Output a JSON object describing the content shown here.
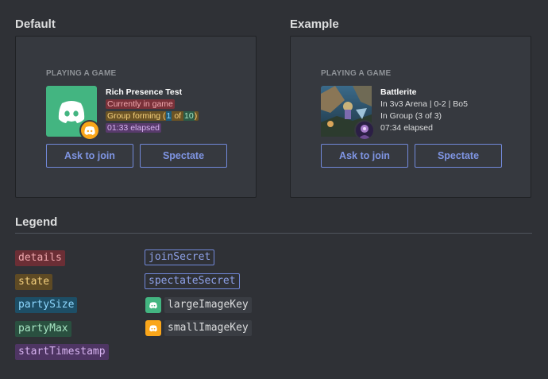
{
  "sections": {
    "default_title": "Default",
    "example_title": "Example",
    "legend_title": "Legend"
  },
  "default_card": {
    "playing_label": "PLAYING A GAME",
    "game_name": "Rich Presence Test",
    "details": "Currently in game",
    "state": "Group forming",
    "party_open": "(",
    "party_size": "1",
    "party_of": "of",
    "party_max": "10",
    "party_close": ")",
    "elapsed": "01:33 elapsed",
    "ask_button": "Ask to join",
    "spectate_button": "Spectate",
    "large_image_color": "#43b581",
    "small_image_color": "#faa61a"
  },
  "example_card": {
    "playing_label": "PLAYING A GAME",
    "game_name": "Battlerite",
    "details": "In 3v3 Arena | 0-2 | Bo5",
    "state": "In Group (3 of 3)",
    "elapsed": "07:34 elapsed",
    "ask_button": "Ask to join",
    "spectate_button": "Spectate"
  },
  "legend": {
    "details": "details",
    "state": "state",
    "party_size": "partySize",
    "party_max": "partyMax",
    "start_timestamp": "startTimestamp",
    "join_secret": "joinSecret",
    "spectate_secret": "spectateSecret",
    "large_image_key": "largeImageKey",
    "small_image_key": "smallImageKey"
  },
  "colors": {
    "background": "#2f3136",
    "panel": "#36393f",
    "accent": "#7289da",
    "green": "#43b581",
    "orange": "#faa61a"
  }
}
